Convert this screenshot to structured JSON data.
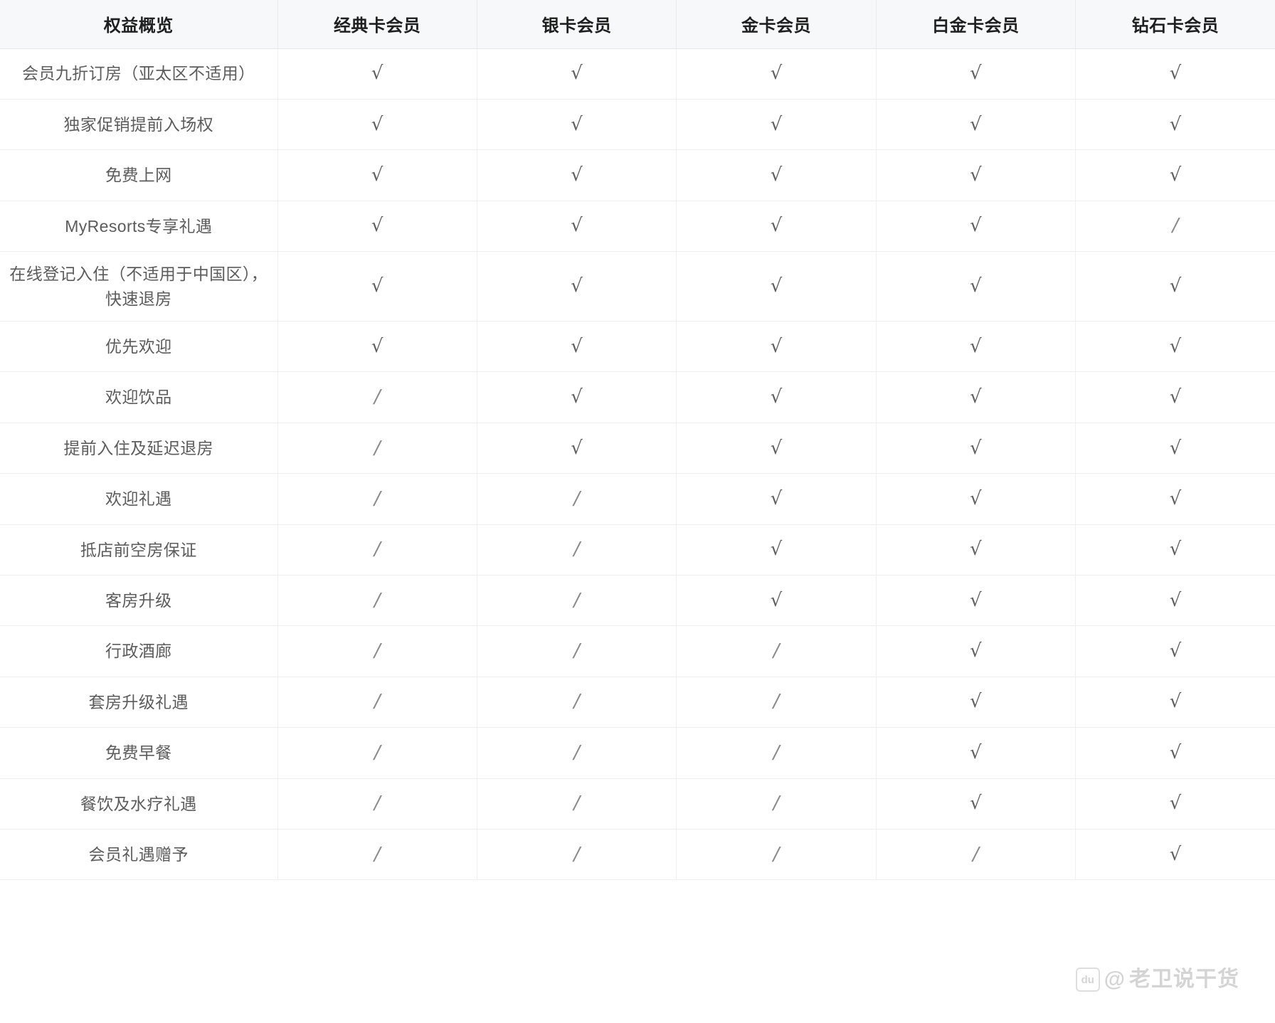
{
  "table": {
    "headers": [
      "权益概览",
      "经典卡会员",
      "银卡会员",
      "金卡会员",
      "白金卡会员",
      "钻石卡会员"
    ],
    "marks": {
      "yes": "√",
      "no": "/"
    },
    "rows": [
      {
        "feature": "会员九折订房（亚太区不适用）",
        "values": [
          "√",
          "√",
          "√",
          "√",
          "√"
        ]
      },
      {
        "feature": "独家促销提前入场权",
        "values": [
          "√",
          "√",
          "√",
          "√",
          "√"
        ]
      },
      {
        "feature": "免费上网",
        "values": [
          "√",
          "√",
          "√",
          "√",
          "√"
        ]
      },
      {
        "feature": "MyResorts专享礼遇",
        "values": [
          "√",
          "√",
          "√",
          "√",
          "/"
        ]
      },
      {
        "feature": "在线登记入住（不适用于中国区），快速退房",
        "values": [
          "√",
          "√",
          "√",
          "√",
          "√"
        ]
      },
      {
        "feature": "优先欢迎",
        "values": [
          "√",
          "√",
          "√",
          "√",
          "√"
        ]
      },
      {
        "feature": "欢迎饮品",
        "values": [
          "/",
          "√",
          "√",
          "√",
          "√"
        ]
      },
      {
        "feature": "提前入住及延迟退房",
        "values": [
          "/",
          "√",
          "√",
          "√",
          "√"
        ]
      },
      {
        "feature": "欢迎礼遇",
        "values": [
          "/",
          "/",
          "√",
          "√",
          "√"
        ]
      },
      {
        "feature": "抵店前空房保证",
        "values": [
          "/",
          "/",
          "√",
          "√",
          "√"
        ]
      },
      {
        "feature": "客房升级",
        "values": [
          "/",
          "/",
          "√",
          "√",
          "√"
        ]
      },
      {
        "feature": "行政酒廊",
        "values": [
          "/",
          "/",
          "/",
          "√",
          "√"
        ]
      },
      {
        "feature": "套房升级礼遇",
        "values": [
          "/",
          "/",
          "/",
          "√",
          "√"
        ]
      },
      {
        "feature": "免费早餐",
        "values": [
          "/",
          "/",
          "/",
          "√",
          "√"
        ]
      },
      {
        "feature": "餐饮及水疗礼遇",
        "values": [
          "/",
          "/",
          "/",
          "√",
          "√"
        ]
      },
      {
        "feature": "会员礼遇赠予",
        "values": [
          "/",
          "/",
          "/",
          "/",
          "√"
        ]
      }
    ]
  },
  "watermark": {
    "logo": "du",
    "at": "@",
    "text": "老卫说干货"
  },
  "colors": {
    "header_bg": "#f7f8f9",
    "header_text": "#1f1f1f",
    "body_text": "#5a5a5a",
    "border": "#efefef",
    "mark": "#5f5f5f"
  }
}
